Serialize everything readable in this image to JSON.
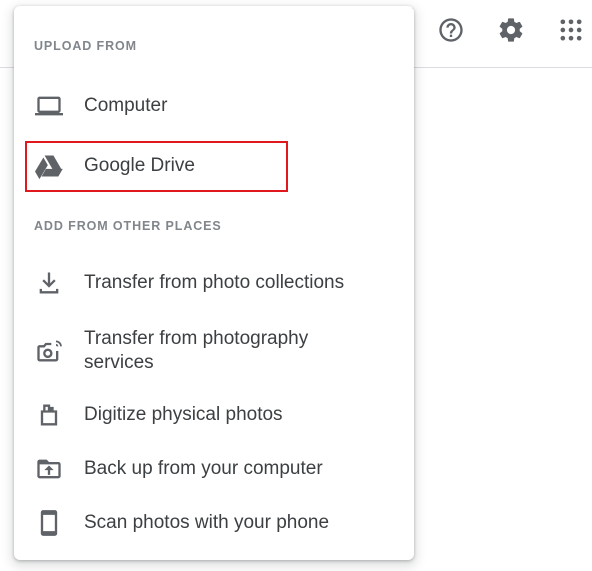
{
  "colors": {
    "highlight_border": "#e0191f",
    "icon": "#5f6368",
    "text": "#3c4043",
    "section_header": "#80868b"
  },
  "top_icons": [
    "help-icon",
    "settings-gear-icon",
    "apps-grid-icon"
  ],
  "menu": {
    "upload_header": "UPLOAD FROM",
    "upload_items": [
      {
        "label": "Computer",
        "icon": "laptop-icon"
      },
      {
        "label": "Google Drive",
        "icon": "google-drive-icon",
        "highlighted": true
      }
    ],
    "other_header": "ADD FROM OTHER PLACES",
    "other_items": [
      {
        "label": "Transfer from photo collections",
        "icon": "download-icon"
      },
      {
        "label": "Transfer from photography services",
        "icon": "camera-sync-icon"
      },
      {
        "label": "Digitize physical photos",
        "icon": "film-photos-icon"
      },
      {
        "label": "Back up from your computer",
        "icon": "folder-upload-icon"
      },
      {
        "label": "Scan photos with your phone",
        "icon": "smartphone-icon"
      }
    ]
  }
}
